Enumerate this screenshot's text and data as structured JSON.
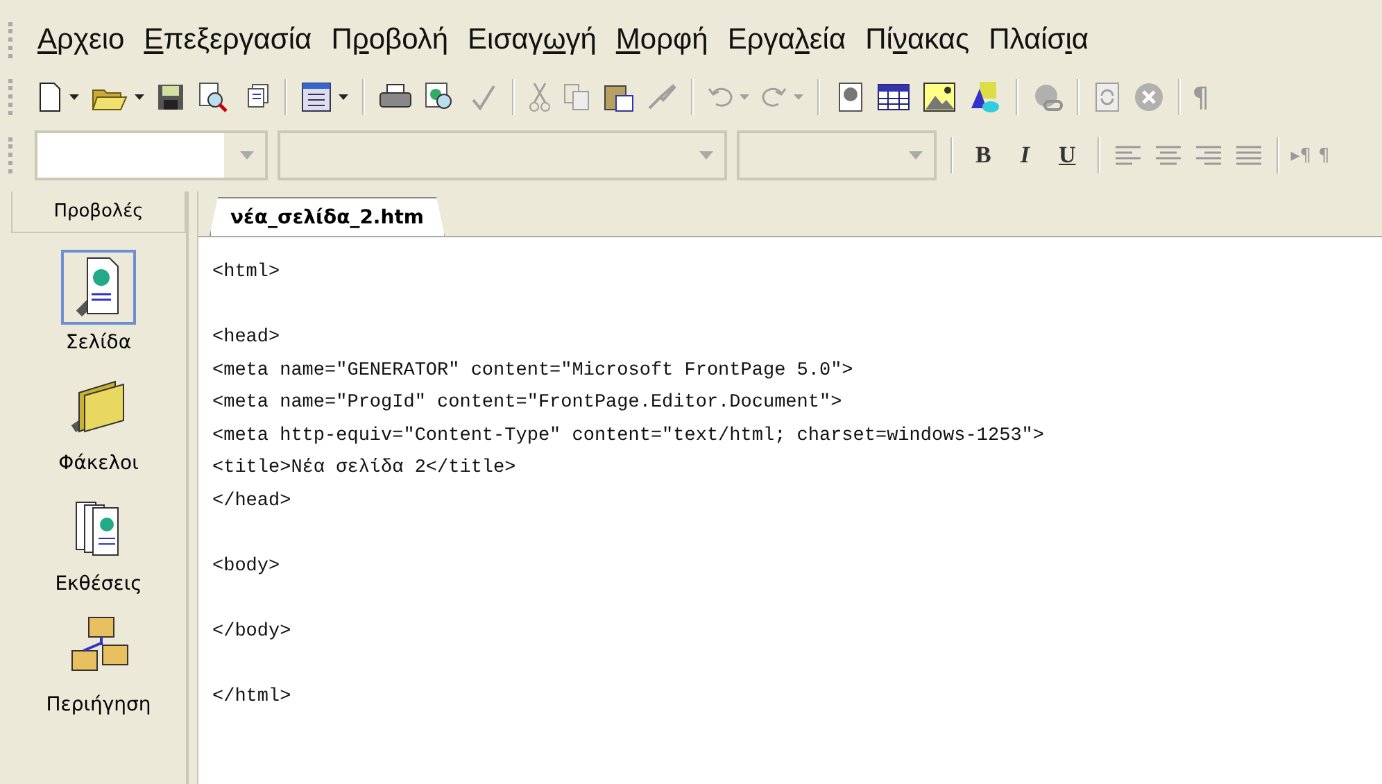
{
  "menu": [
    {
      "key": "Α",
      "after": "ρχειο"
    },
    {
      "key": "Ε",
      "after": "πεξεργασία"
    },
    {
      "before": "Π",
      "key": "ρ",
      "after": "οβολή"
    },
    {
      "before": "Εισαγ",
      "key": "ω",
      "after": "γή"
    },
    {
      "key": "Μ",
      "after": "ορφή"
    },
    {
      "before": "Εργα",
      "key": "λ",
      "after": "εία"
    },
    {
      "before": "Πί",
      "key": "ν",
      "after": "ακας"
    },
    {
      "before": "Πλαίσ",
      "key": "ι",
      "after": "α"
    }
  ],
  "standard_toolbar": {
    "pilcrow": "¶"
  },
  "format_toolbar": {
    "bold": "B",
    "italic": "I",
    "underline": "U",
    "pilcrows": [
      "▸¶",
      "¶"
    ]
  },
  "views_panel": {
    "title": "Προβολές",
    "items": [
      {
        "kind": "page",
        "label": "Σελίδα",
        "selected": true
      },
      {
        "kind": "folders",
        "label": "Φάκελοι",
        "selected": false
      },
      {
        "kind": "reports",
        "label": "Εκθέσεις",
        "selected": false
      },
      {
        "kind": "navigation",
        "label": "Περιήγηση",
        "selected": false
      }
    ]
  },
  "tabs": [
    {
      "label": "νέα_σελίδα_2.htm",
      "selected": true
    }
  ],
  "code_blocks": [
    [
      "<html>"
    ],
    [
      "<head>",
      "<meta name=\"GENERATOR\" content=\"Microsoft FrontPage 5.0\">",
      "<meta name=\"ProgId\" content=\"FrontPage.Editor.Document\">",
      "<meta http-equiv=\"Content-Type\" content=\"text/html; charset=windows-1253\">",
      "<title>Νέα σελίδα 2</title>",
      "</head>"
    ],
    [
      "<body>"
    ],
    [
      "</body>"
    ],
    [
      "</html>"
    ]
  ]
}
